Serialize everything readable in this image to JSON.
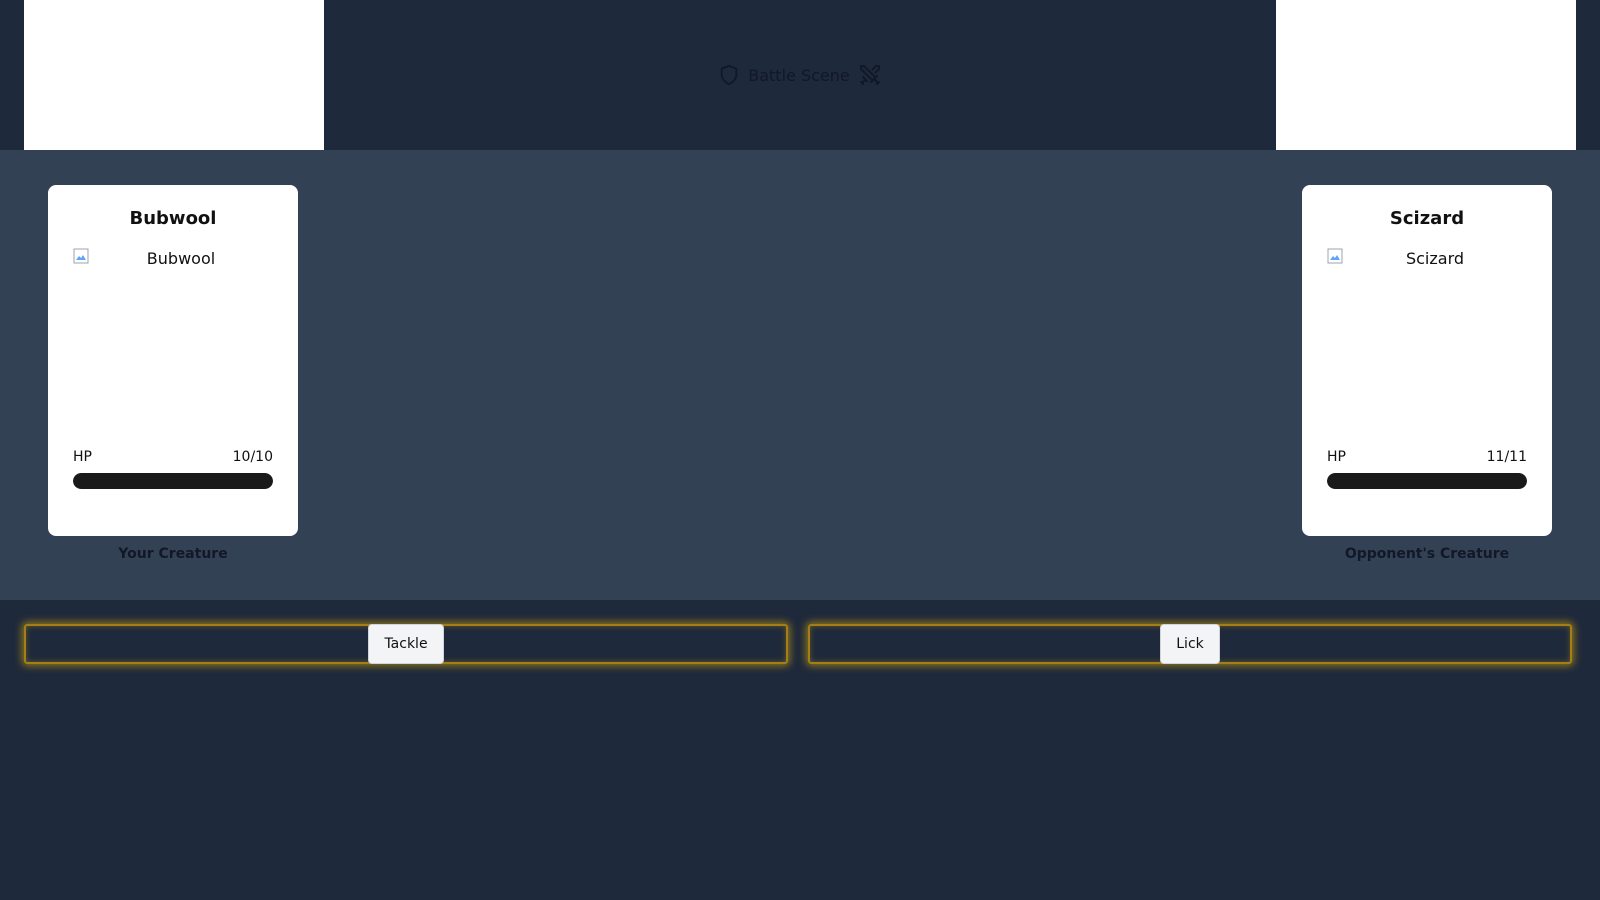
{
  "header": {
    "title": "Battle Scene",
    "left_icon": "shield-icon",
    "right_icon": "crossed-swords-icon"
  },
  "player": {
    "name": "Bubwool",
    "image_alt": "Bubwool",
    "hp_label": "HP",
    "hp_current": 10,
    "hp_max": 10,
    "hp_text": "10/10",
    "caption": "Your Creature"
  },
  "opponent": {
    "name": "Scizard",
    "image_alt": "Scizard",
    "hp_label": "HP",
    "hp_current": 11,
    "hp_max": 11,
    "hp_text": "11/11",
    "caption": "Opponent's Creature"
  },
  "moves": [
    {
      "label": "Tackle"
    },
    {
      "label": "Lick"
    }
  ],
  "colors": {
    "background": "#1e293b",
    "arena": "#334155",
    "move_glow": "#eab308",
    "hp_fill": "#1a1a1a"
  }
}
